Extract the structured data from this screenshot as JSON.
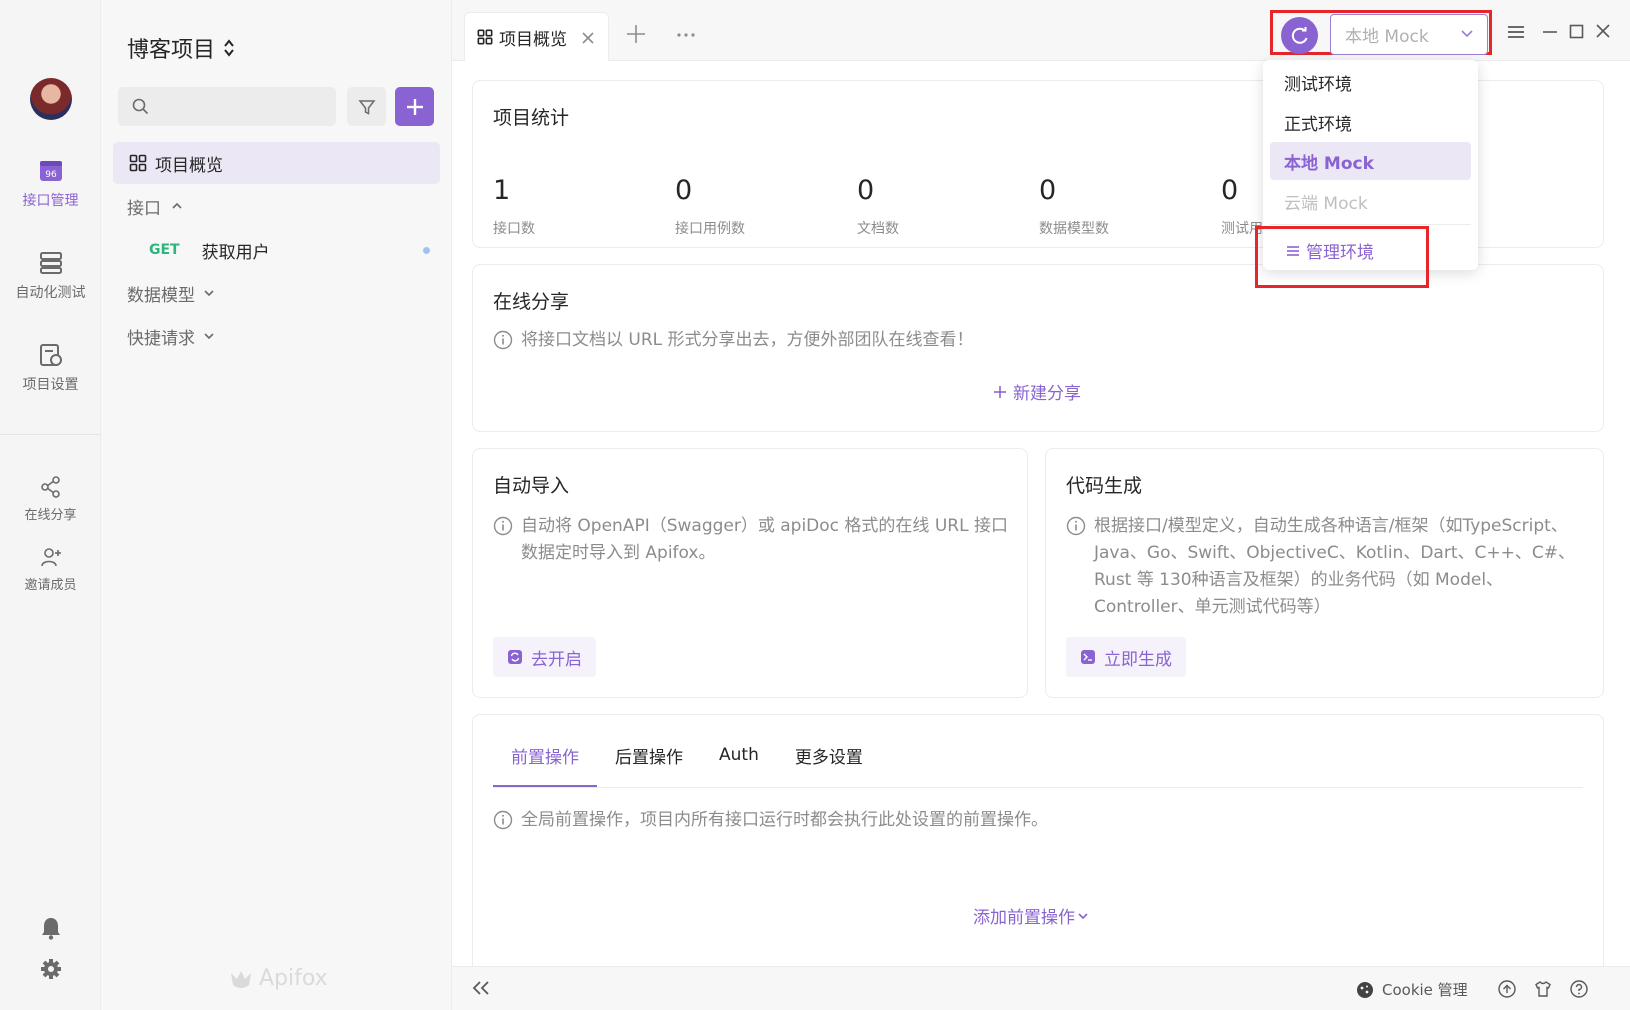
{
  "rail": {
    "items": [
      {
        "label": "接口管理",
        "icon": "api-management-icon",
        "active": true
      },
      {
        "label": "自动化测试",
        "icon": "automation-test-icon",
        "active": false
      },
      {
        "label": "项目设置",
        "icon": "project-settings-icon",
        "active": false
      },
      {
        "label": "在线分享",
        "icon": "share-icon",
        "active": false
      },
      {
        "label": "邀请成员",
        "icon": "invite-member-icon",
        "active": false
      }
    ],
    "api_badge": "96"
  },
  "sidebar": {
    "project_title": "博客项目",
    "tree": [
      {
        "label": "项目概览",
        "active": true
      },
      {
        "label": "接口",
        "expanded": true
      },
      {
        "method": "GET",
        "label": "获取用户"
      },
      {
        "label": "数据模型",
        "expanded": false
      },
      {
        "label": "快捷请求",
        "expanded": false
      }
    ],
    "logo_text": "Apifox"
  },
  "topbar": {
    "tab_label": "项目概览",
    "env_selected": "本地 Mock"
  },
  "env_dropdown": {
    "options": [
      {
        "label": "测试环境",
        "state": "normal"
      },
      {
        "label": "正式环境",
        "state": "normal"
      },
      {
        "label": "本地 Mock",
        "state": "selected"
      },
      {
        "label": "云端 Mock",
        "state": "disabled"
      }
    ],
    "manage_label": "管理环境"
  },
  "stats": {
    "title": "项目统计",
    "items": [
      {
        "value": "1",
        "label": "接口数"
      },
      {
        "value": "0",
        "label": "接口用例数"
      },
      {
        "value": "0",
        "label": "文档数"
      },
      {
        "value": "0",
        "label": "数据模型数"
      },
      {
        "value": "0",
        "label": "测试用"
      }
    ]
  },
  "share": {
    "title": "在线分享",
    "hint": "将接口文档以 URL 形式分享出去，方便外部团队在线查看！",
    "new_label": "新建分享"
  },
  "auto_import": {
    "title": "自动导入",
    "hint": "自动将 OpenAPI（Swagger）或 apiDoc 格式的在线 URL 接口数据定时导入到 Apifox。",
    "button": "去开启"
  },
  "codegen": {
    "title": "代码生成",
    "hint": "根据接口/模型定义，自动生成各种语言/框架（如TypeScript、Java、Go、Swift、ObjectiveC、Kotlin、Dart、C++、C#、Rust 等 130种语言及框架）的业务代码（如 Model、Controller、单元测试代码等）",
    "button": "立即生成"
  },
  "settings": {
    "tabs": [
      "前置操作",
      "后置操作",
      "Auth",
      "更多设置"
    ],
    "hint": "全局前置操作，项目内所有接口运行时都会执行此处设置的前置操作。",
    "add_label": "添加前置操作"
  },
  "statusbar": {
    "cookie_label": "Cookie 管理"
  },
  "colors": {
    "accent": "#8a63d2",
    "highlight_box": "#e5262a",
    "get_method": "#2db67c"
  }
}
